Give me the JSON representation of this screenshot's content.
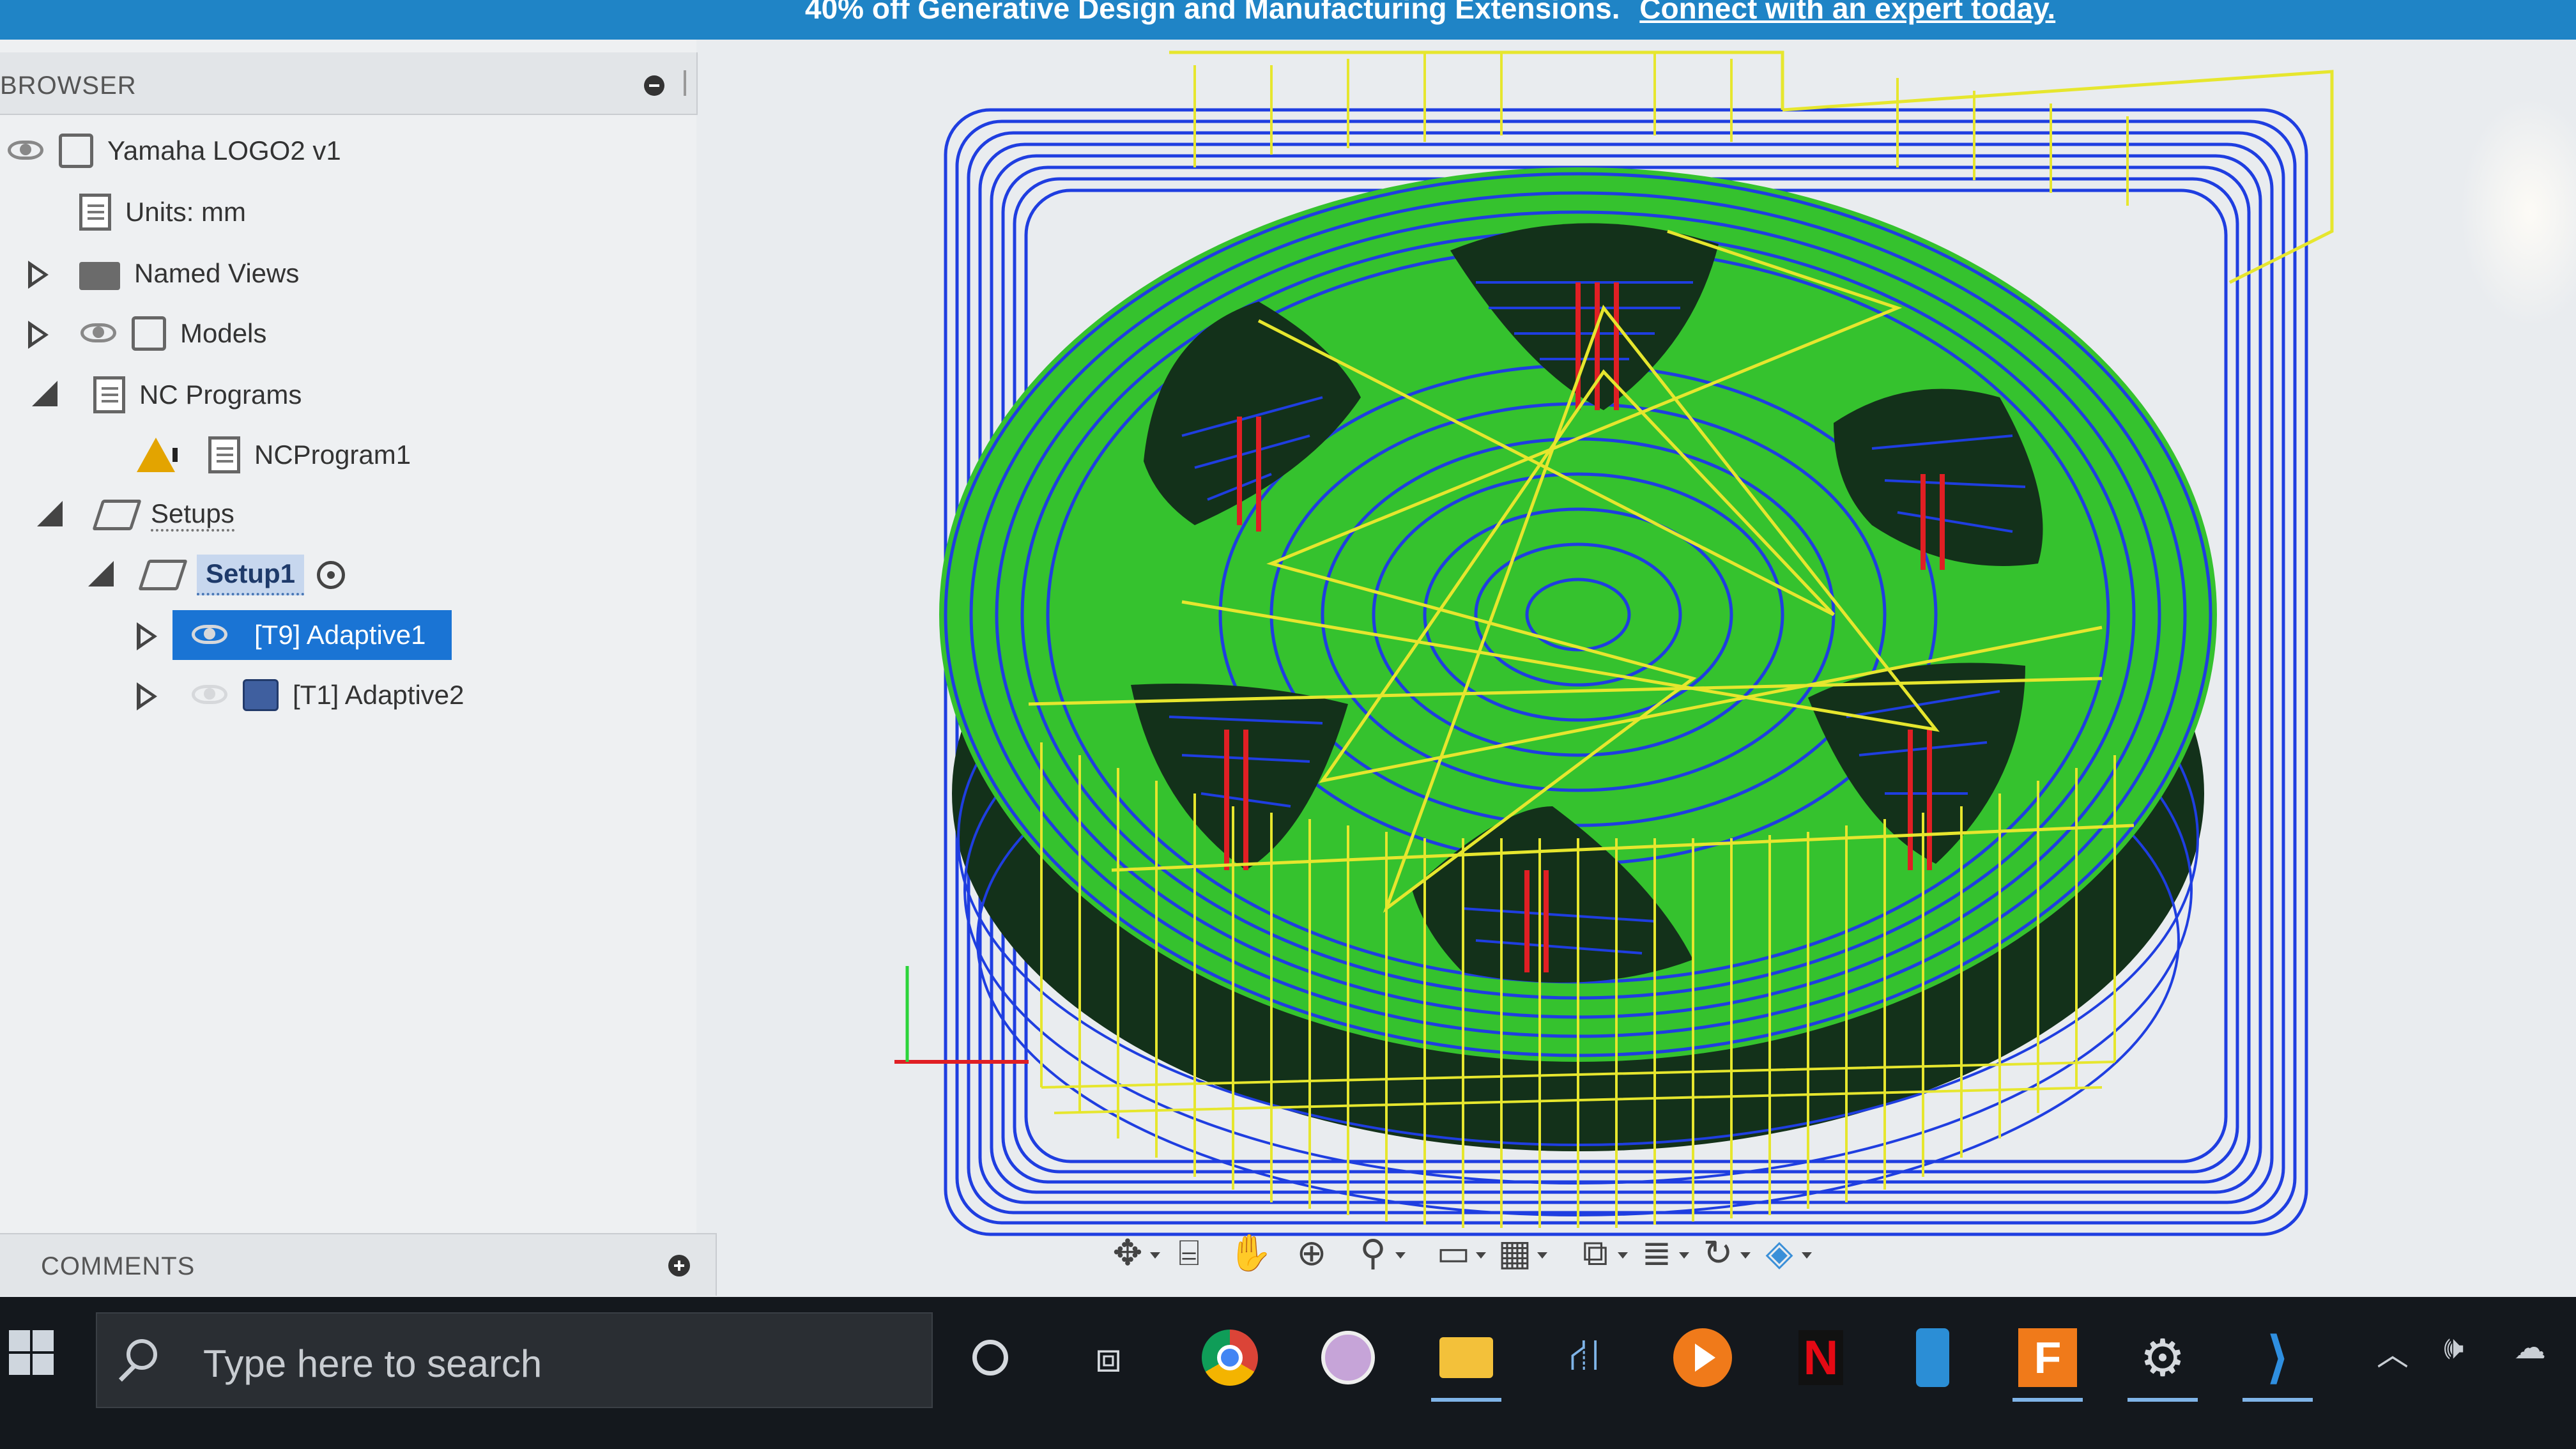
{
  "banner": {
    "text": "40% off Generative Design and Manufacturing Extensions.",
    "link": "Connect with an expert today."
  },
  "browser": {
    "title": "BROWSER",
    "items": [
      {
        "label": "Yamaha LOGO2 v1"
      },
      {
        "label": "Units: mm"
      },
      {
        "label": "Named Views"
      },
      {
        "label": "Models"
      },
      {
        "label": "NC Programs"
      },
      {
        "label": "NCProgram1"
      },
      {
        "label": "Setups"
      },
      {
        "label": "Setup1"
      },
      {
        "label": "[T9] Adaptive1"
      },
      {
        "label": "[T1] Adaptive2"
      }
    ]
  },
  "comments": {
    "title": "COMMENTS"
  },
  "navbar": {
    "icons": [
      "orbit-icon",
      "look-at-icon",
      "pan-icon",
      "zoom-icon",
      "fit-icon",
      "display-settings-icon",
      "grid-icon",
      "viewports-icon",
      "effects-icon",
      "refresh-icon",
      "object-visibility-icon"
    ]
  },
  "taskbar": {
    "search_placeholder": "Type here to search",
    "apps": [
      "cortana-icon",
      "task-view-icon",
      "chrome-icon",
      "podcast-app-icon",
      "file-explorer-icon",
      "network-app-icon",
      "media-player-icon",
      "netflix-icon",
      "phone-app-icon",
      "fusion-360-icon",
      "settings-icon",
      "vscode-icon"
    ]
  },
  "colors": {
    "banner": "#1f84c6",
    "selection": "#1a74d4",
    "toolpath_blue": "#1f3ee0",
    "toolpath_yellow": "#e6e62e",
    "model_green": "#35c22e",
    "plunge_red": "#e01f24"
  }
}
